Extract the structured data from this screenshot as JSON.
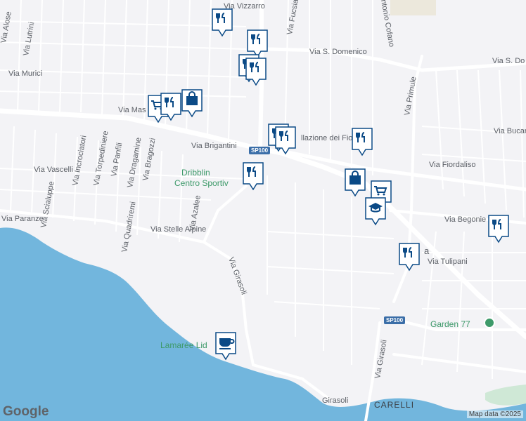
{
  "map": {
    "streets": [
      "Via Vizzarro",
      "Via Alose",
      "Via Lutrini",
      "Via Murici",
      "Via Fucsia",
      "Via S. Domenico",
      "Via S. Do",
      "ntonio Cofano",
      "Via Mas",
      "Via Brigantini",
      "llazione dei Fio",
      "Via Primule",
      "Via Fiordaliso",
      "Via Bucar",
      "Via Incrociatori",
      "Via Torpediniere",
      "Via Panfili",
      "Via Dragamine",
      "Via Bragozzi",
      "Via Vascelli",
      "Via Scialuppe",
      "Via Paranze",
      "Via Quadriremi",
      "Via Azalee",
      "Via Stelle Alpine",
      "Via Girasoli",
      "Via Begonie",
      "Via Tulipani",
      "Via Girasoli",
      "Girasoli"
    ],
    "roads": [
      "SP100",
      "SP100"
    ],
    "places": {
      "dribbling_1": "Dribblin",
      "dribbling_2": "Centro Sportiv",
      "lamaree": "Lamarée Lid",
      "garden": "Garden 77",
      "carelli": "CARELLI",
      "fragment": "a"
    },
    "brand": "Google",
    "attribution": "Map data ©2025",
    "colors": {
      "water": "#72b6dd",
      "land": "#f3f3f6",
      "road": "#ffffff",
      "pin": "#0b4a86",
      "park": "#3e9a6a"
    }
  },
  "pins": [
    {
      "name": "restaurant-pin",
      "icon": "restaurant-icon"
    },
    {
      "name": "restaurant-pin",
      "icon": "restaurant-icon"
    },
    {
      "name": "restaurant-pin",
      "icon": "restaurant-icon"
    },
    {
      "name": "restaurant-pin",
      "icon": "restaurant-icon"
    },
    {
      "name": "grocery-pin",
      "icon": "cart-icon"
    },
    {
      "name": "restaurant-pin",
      "icon": "restaurant-icon"
    },
    {
      "name": "shopping-pin",
      "icon": "shopping-bag-icon"
    },
    {
      "name": "restaurant-pin",
      "icon": "restaurant-icon"
    },
    {
      "name": "restaurant-pin",
      "icon": "restaurant-icon"
    },
    {
      "name": "restaurant-pin",
      "icon": "restaurant-icon"
    },
    {
      "name": "shopping-pin",
      "icon": "shopping-bag-icon"
    },
    {
      "name": "grocery-pin",
      "icon": "cart-icon"
    },
    {
      "name": "school-pin",
      "icon": "school-icon"
    },
    {
      "name": "restaurant-pin",
      "icon": "restaurant-icon"
    },
    {
      "name": "restaurant-pin",
      "icon": "restaurant-icon"
    },
    {
      "name": "restaurant-pin",
      "icon": "restaurant-icon"
    },
    {
      "name": "cafe-pin",
      "icon": "coffee-cup-icon"
    }
  ]
}
